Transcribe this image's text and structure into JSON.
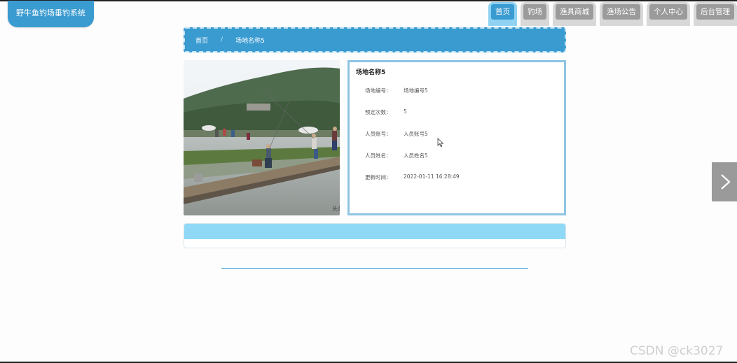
{
  "app": {
    "title": "野牛鱼钓场垂钓系统"
  },
  "nav": {
    "items": [
      {
        "label": "首页",
        "active": true
      },
      {
        "label": "钓场",
        "active": false
      },
      {
        "label": "渔具商城",
        "active": false
      },
      {
        "label": "渔场公告",
        "active": false
      },
      {
        "label": "个人中心",
        "active": false
      },
      {
        "label": "后台管理",
        "active": false
      }
    ]
  },
  "breadcrumb": {
    "home": "首页",
    "separator": "/",
    "current": "场地名称5"
  },
  "detail": {
    "title": "场地名称5",
    "fields": [
      {
        "label": "场地编号：",
        "value": "场地编号5"
      },
      {
        "label": "预定次数：",
        "value": "5"
      },
      {
        "label": "人员账号：",
        "value": "人员账号5"
      },
      {
        "label": "人员姓名：",
        "value": "人员姓名5"
      },
      {
        "label": "更新时间：",
        "value": "2022-01-11 16:28:49"
      }
    ]
  },
  "photo": {
    "corner_text": "头条"
  },
  "watermark": "CSDN @ck3027",
  "colors": {
    "accent": "#3a9bd0",
    "accent_light": "#8fd8f6",
    "inactive": "#9b9b9b"
  },
  "icons": {
    "next": "chevron-right-icon",
    "cursor": "mouse-pointer-icon"
  }
}
